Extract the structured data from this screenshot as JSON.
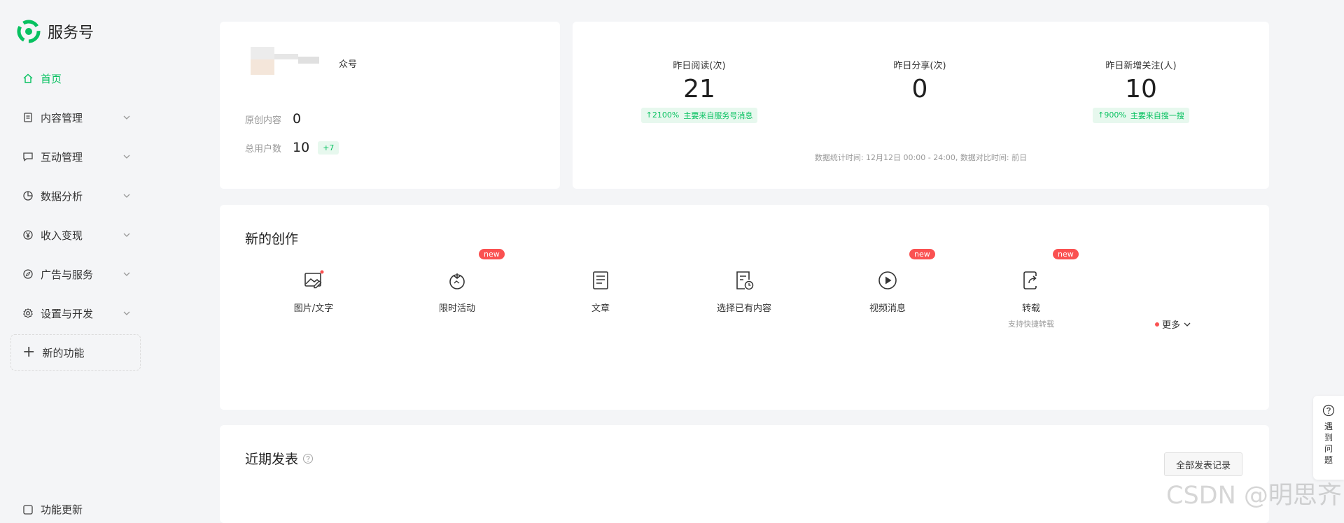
{
  "brand": {
    "name": "服务号",
    "color": "#07c160",
    "logo_icon": "wechat-service-logo-icon"
  },
  "nav": [
    {
      "label": "首页",
      "icon": "home-icon",
      "active": true
    },
    {
      "label": "内容管理",
      "icon": "document-icon"
    },
    {
      "label": "互动管理",
      "icon": "chat-icon"
    },
    {
      "label": "数据分析",
      "icon": "pie-chart-icon"
    },
    {
      "label": "收入变现",
      "icon": "yen-icon"
    },
    {
      "label": "广告与服务",
      "icon": "compass-icon"
    },
    {
      "label": "设置与开发",
      "icon": "gear-icon"
    }
  ],
  "new_function": {
    "label": "新的功能"
  },
  "func_update": {
    "label": "功能更新"
  },
  "account": {
    "name_suffix": "众号",
    "original_label": "原创内容",
    "original_value": "0",
    "users_label": "总用户数",
    "users_value": "10",
    "users_delta": "+7"
  },
  "stats": [
    {
      "title": "昨日阅读(次)",
      "value": "21",
      "badge_pct": "↑2100%",
      "badge_note": "主要来自服务号消息"
    },
    {
      "title": "昨日分享(次)",
      "value": "0"
    },
    {
      "title": "昨日新增关注(人)",
      "value": "10",
      "badge_pct": "↑900%",
      "badge_note": "主要来自搜一搜"
    }
  ],
  "stats_footer": "数据统计时间: 12月12日 00:00 - 24:00, 数据对比时间: 前日",
  "create": {
    "title": "新的创作",
    "new_badge": "new",
    "tools": [
      {
        "label": "图片/文字",
        "icon": "image-text-icon"
      },
      {
        "label": "限时活动",
        "icon": "tomato-icon"
      },
      {
        "label": "文章",
        "icon": "article-icon"
      },
      {
        "label": "选择已有内容",
        "icon": "select-content-icon"
      },
      {
        "label": "视频消息",
        "icon": "play-icon"
      },
      {
        "label": "转载",
        "icon": "repost-icon",
        "sub": "支持快捷转载"
      }
    ],
    "more_label": "更多"
  },
  "recent": {
    "title": "近期发表",
    "all_button": "全部发表记录",
    "first_item": "··"
  },
  "help_float": {
    "label": "遇到问题"
  },
  "watermark": "CSDN @明思齐",
  "colors": {
    "accent": "#07c160",
    "badge_bg": "#e7f8ee",
    "new_badge": "#fa5151"
  }
}
